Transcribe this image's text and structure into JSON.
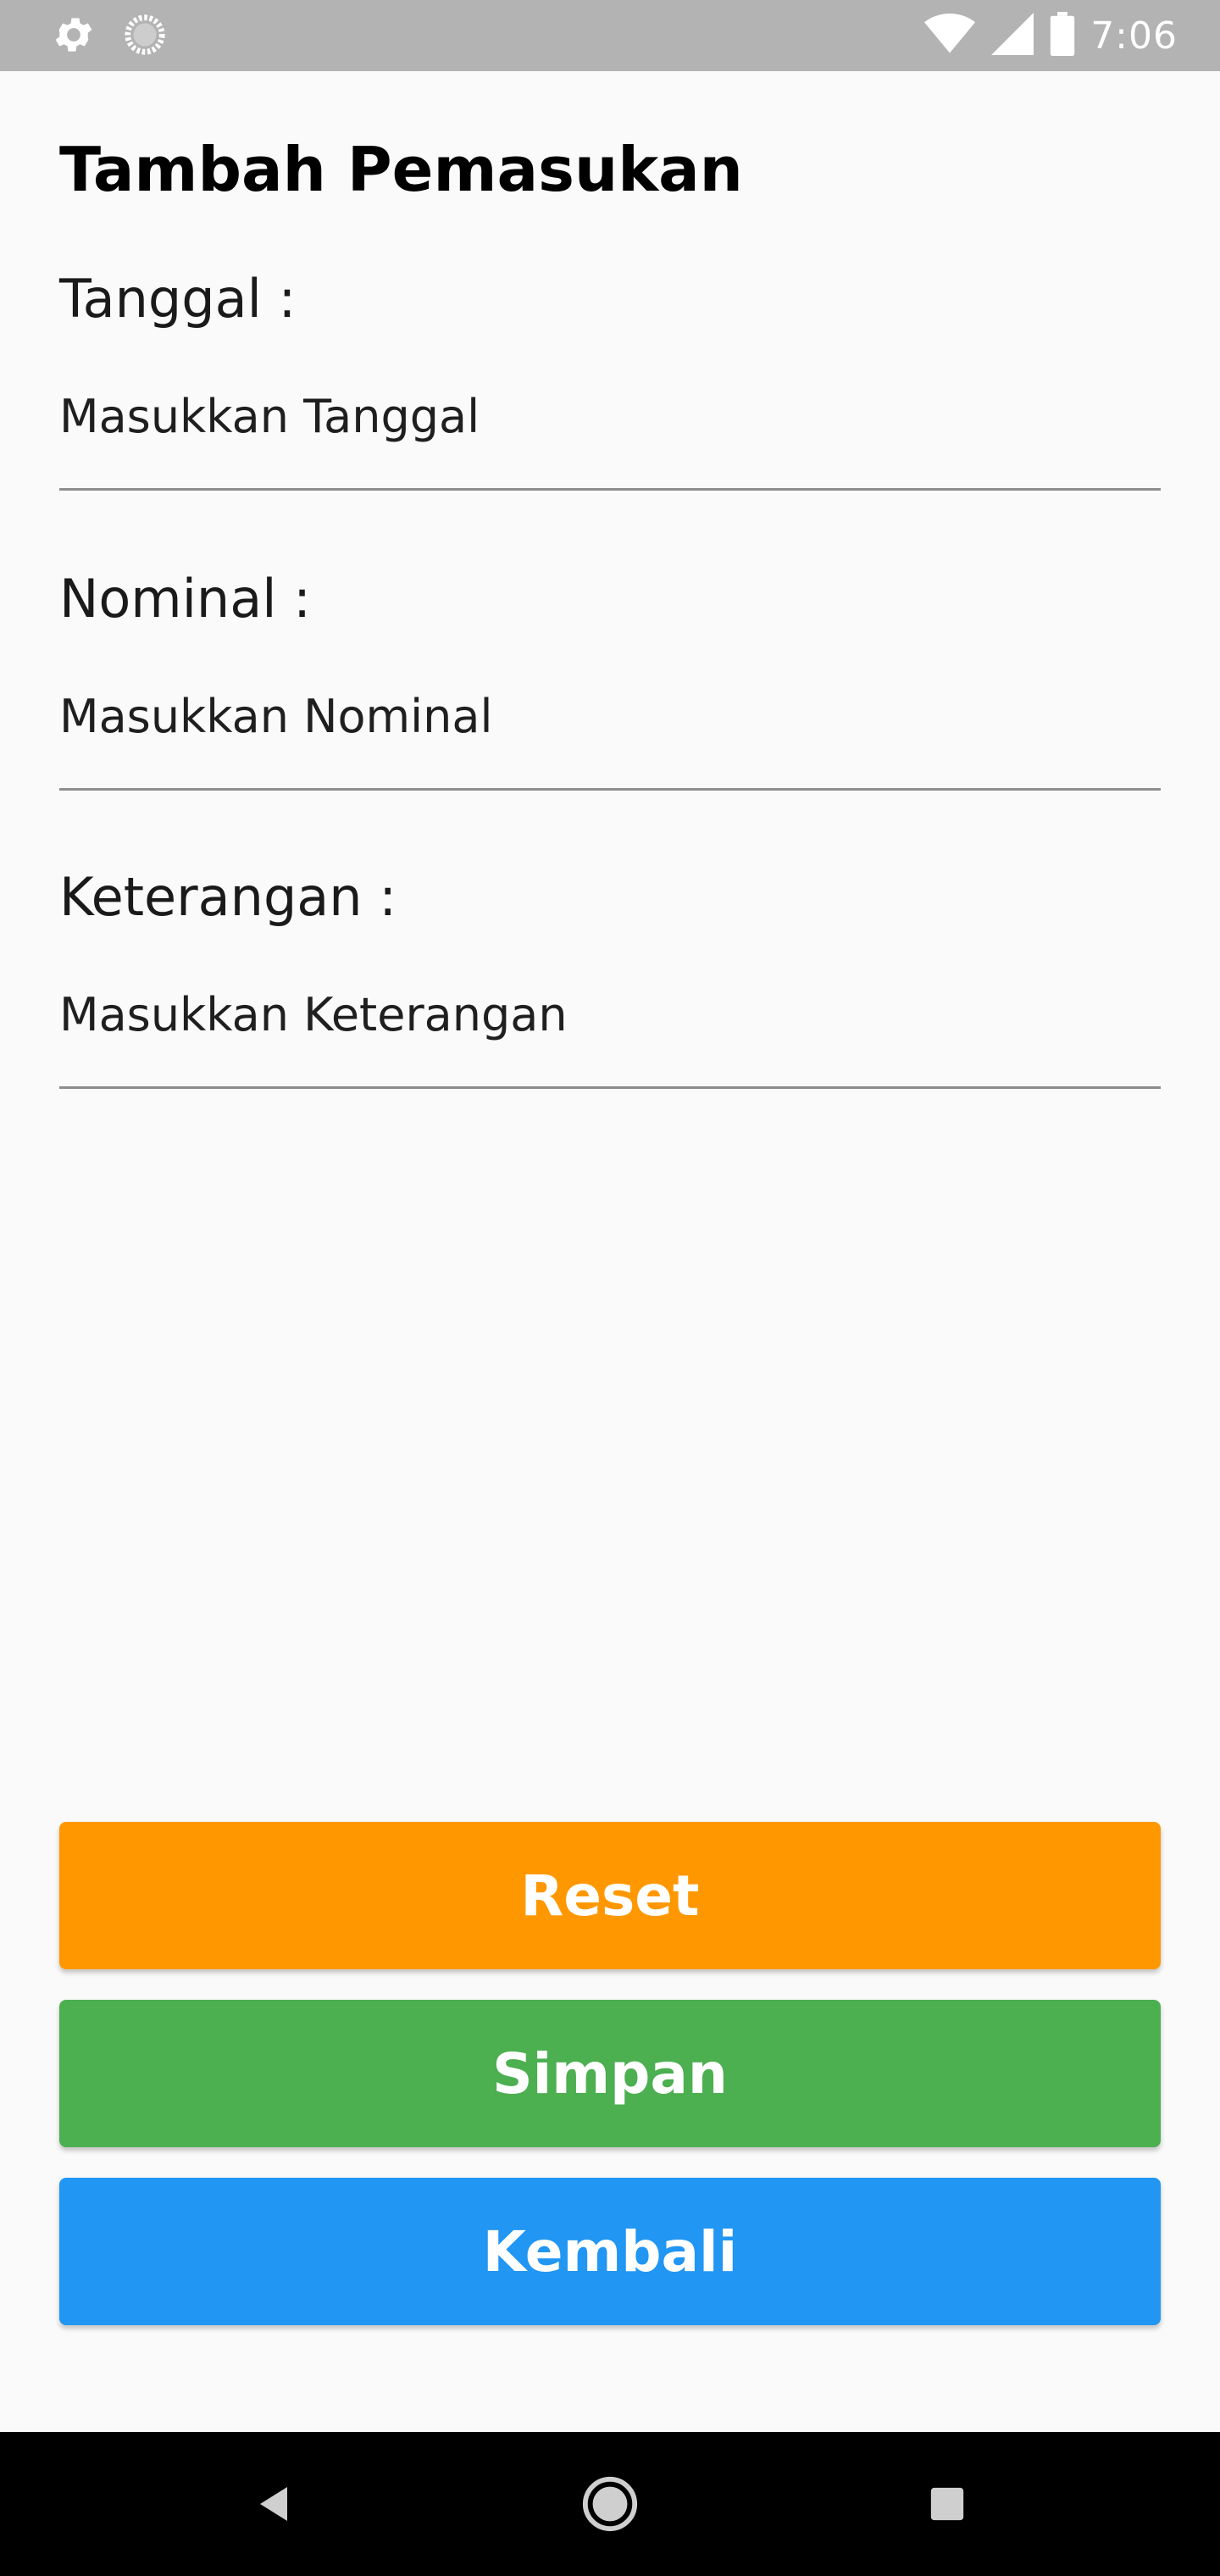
{
  "status_bar": {
    "time": "7:06",
    "icons": [
      "settings-icon",
      "loading-icon",
      "wifi-icon",
      "signal-icon",
      "battery-icon"
    ],
    "background": "#b3b3b3"
  },
  "page": {
    "title": "Tambah Pemasukan"
  },
  "form": {
    "tanggal": {
      "label": "Tanggal :",
      "placeholder": "Masukkan Tanggal",
      "value": ""
    },
    "nominal": {
      "label": "Nominal :",
      "placeholder": "Masukkan Nominal",
      "value": ""
    },
    "keterangan": {
      "label": "Keterangan :",
      "placeholder": "Masukkan Keterangan",
      "value": ""
    }
  },
  "buttons": {
    "reset": {
      "label": "Reset",
      "color": "#ff9800"
    },
    "simpan": {
      "label": "Simpan",
      "color": "#4caf50"
    },
    "kembali": {
      "label": "Kembali",
      "color": "#2196f3"
    }
  },
  "nav_bar": {
    "icons": [
      "back-icon",
      "home-icon",
      "recents-icon"
    ]
  }
}
